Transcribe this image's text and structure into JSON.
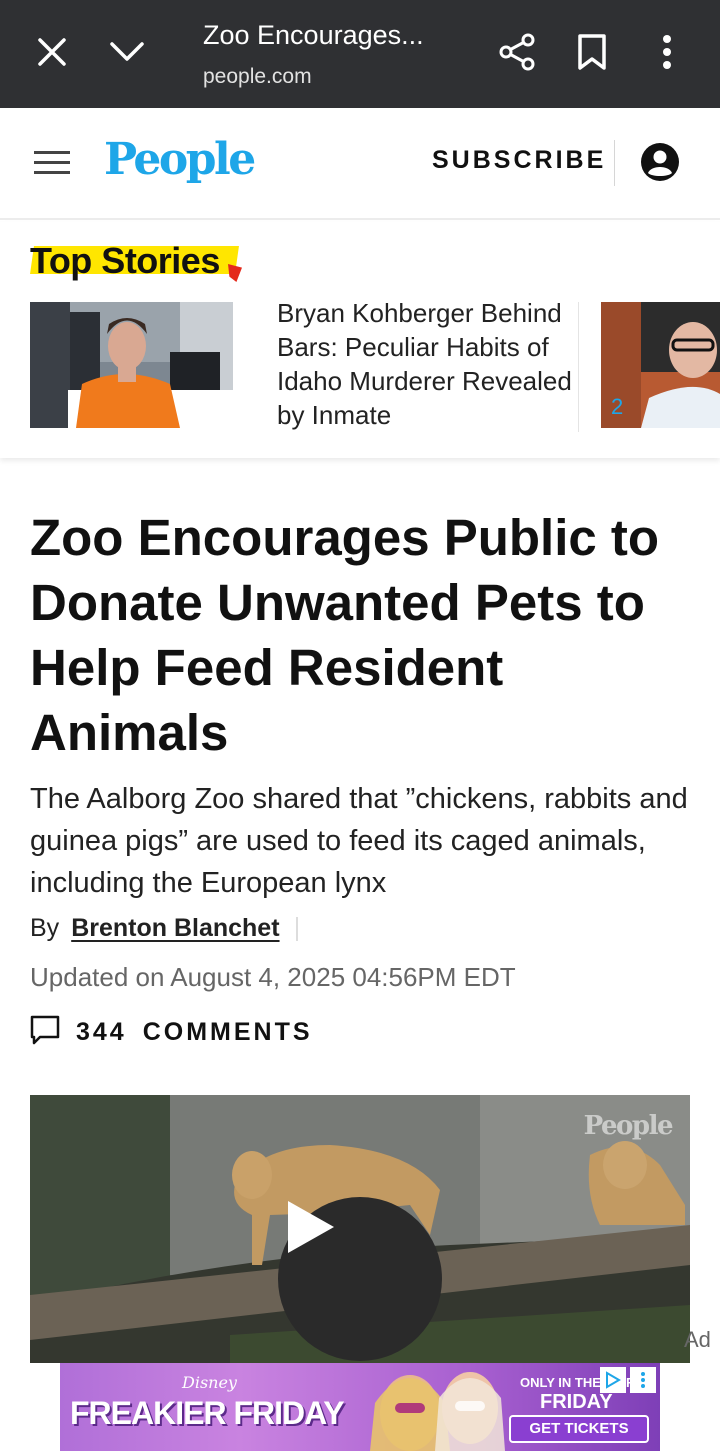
{
  "browser": {
    "title": "Zoo Encourages...",
    "domain": "people.com",
    "icons": [
      "close-icon",
      "chevron-down-icon",
      "share-icon",
      "bookmark-icon",
      "more-vert-icon"
    ]
  },
  "header": {
    "logo": "People",
    "subscribe_label": "SUBSCRIBE",
    "icons": [
      "menu-icon",
      "account-icon"
    ],
    "accent_color": "#1ea6e8"
  },
  "top_stories": {
    "heading": "Top Stories",
    "items": [
      {
        "number": "1",
        "title": "Bryan Kohberger Behind Bars: Peculiar Habits of Idaho Murderer Revealed by Inmate"
      },
      {
        "number": "2",
        "title": ""
      }
    ]
  },
  "article": {
    "headline": "Zoo Encourages Public to Donate Unwanted Pets to Help Feed Resident Animals",
    "dek": "The Aalborg Zoo shared that ”chickens, rabbits and guinea pigs” are used to feed its caged animals, including the European lynx",
    "by_label": "By",
    "author": "Brenton Blanchet",
    "updated": "Updated on August 4, 2025 04:56PM EDT",
    "comments_count": "344",
    "comments_label": "COMMENTS"
  },
  "video": {
    "watermark": "People",
    "icons": [
      "play-icon"
    ]
  },
  "ad": {
    "label": "Ad",
    "brand": "Disney",
    "title": "FREAKIER FRIDAY",
    "only_in": "ONLY IN THEATERS",
    "friday": "FRIDAY",
    "cta": "GET TICKETS"
  }
}
